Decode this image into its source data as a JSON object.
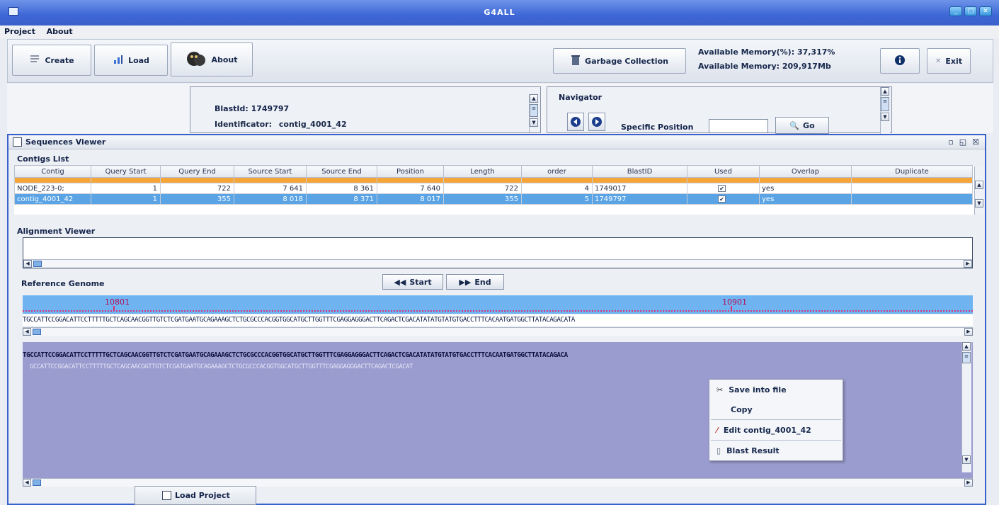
{
  "window": {
    "title": "G4ALL"
  },
  "menubar": {
    "items": [
      "Project",
      "About"
    ]
  },
  "toolbar": {
    "create_label": "Create",
    "load_label": "Load",
    "about_label": "About",
    "gc_label": "Garbage Collection",
    "mem_percent": "Available Memory(%): 37,317%",
    "mem_mb": "Available Memory: 209,917Mb",
    "exit_label": "Exit"
  },
  "blast_panel": {
    "blastid": "BlastId: 1749797",
    "identificator_label": "Identificator:",
    "identificator_value": "contig_4001_42"
  },
  "navigator": {
    "title": "Navigator",
    "specific_position_label": "Specific Position",
    "specific_position_value": "",
    "go_label": "Go"
  },
  "sequences_viewer": {
    "title": "Sequences Viewer",
    "contigs_list_label": "Contigs List",
    "columns": [
      "Contig",
      "Query Start",
      "Query End",
      "Source Start",
      "Source End",
      "Position",
      "Length",
      "order",
      "BlastID",
      "Used",
      "Overlap",
      "Duplicate"
    ],
    "rows": [
      {
        "contig": "NODE_223-0;",
        "query_start": "1",
        "query_end": "722",
        "source_start": "7 641",
        "source_end": "8 361",
        "position": "7 640",
        "length": "722",
        "order": "4",
        "blastid": "1749017",
        "used": "✔",
        "overlap": "yes",
        "duplicate": ""
      },
      {
        "contig": "contig_4001_42",
        "query_start": "1",
        "query_end": "355",
        "source_start": "8 018",
        "source_end": "8 371",
        "position": "8 017",
        "length": "355",
        "order": "5",
        "blastid": "1749797",
        "used": "✔",
        "overlap": "yes",
        "duplicate": ""
      }
    ],
    "alignment_viewer_label": "Alignment Viewer",
    "reference_genome_label": "Reference Genome",
    "start_label": "Start",
    "end_label": "End",
    "ruler": {
      "mark1": "10801",
      "mark2": "10901"
    },
    "reference_sequence": "TGCCATTCCGGACATTCCTTTTTGCTCAGCAACGGTTGTCTCGATGAATGCAGAAAGCTCTGCGCCCACGGTGGCATGCTTGGTTTCGAGGAGGGACTTCAGACTCGACATATATGTATGTGACCTTTCACAATGATGGCTTATACAGACATA",
    "aligned_sequence_1": "TGCCATTCCGGACATTCCTTTTTGCTCAGCAACGGTTGTCTCGATGAATGCAGAAAGCTCTGCGCCCACGGTGGCATGCTTGGTTTCGAGGAGGGACTTCAGACTCGACATATATGTATGTGACCTTTCACAATGATGGCTTATACAGACA",
    "aligned_sequence_2": "GCCATTCCGGACATTCCTTTTTGCTCAGCAACGGTTGTCTCGATGAATGCAGAAAGCTCTGCGCCCACGGTGGCATGCTTGGTTTCGAGGAGGGACTTCAGACTCGACAT"
  },
  "context_menu": {
    "save_label": "Save into file",
    "copy_label": "Copy",
    "edit_label": "Edit contig_4001_42",
    "blast_label": "Blast Result"
  },
  "bottom_tab": {
    "label": "Load Project"
  },
  "colors": {
    "title_blue": "#3e67d6",
    "selection_blue": "#5aa4e6",
    "orange_row": "#f5a53a",
    "alignment_bg": "#9a9bcf",
    "ruler_bg": "#6fb4f0"
  }
}
